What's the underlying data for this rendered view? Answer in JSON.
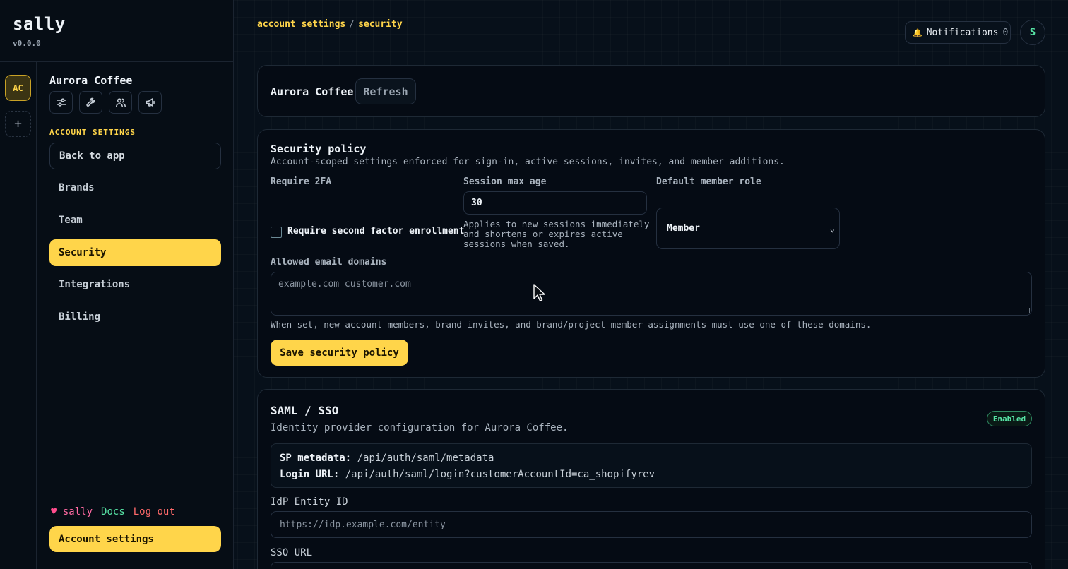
{
  "app": {
    "name": "sally",
    "version": "v0.0.0"
  },
  "rail": {
    "account_initials": "AC",
    "add_label": "+"
  },
  "sidebar": {
    "account_name": "Aurora Coffee",
    "tools": [
      "sliders-icon",
      "wrench-icon",
      "users-icon",
      "megaphone-icon"
    ],
    "section_label": "ACCOUNT SETTINGS",
    "items": [
      {
        "label": "Back to app"
      },
      {
        "label": "Brands"
      },
      {
        "label": "Team"
      },
      {
        "label": "Security"
      },
      {
        "label": "Integrations"
      },
      {
        "label": "Billing"
      }
    ],
    "footer": {
      "heart": "♥",
      "sally": "sally",
      "docs": "Docs",
      "logout": "Log out"
    },
    "account_button": "Account settings"
  },
  "header": {
    "breadcrumb_a": "account settings",
    "breadcrumb_sep": "/",
    "breadcrumb_b": "security",
    "notifications_label": "Notifications",
    "notifications_count": "0",
    "avatar": "S"
  },
  "account_card": {
    "name": "Aurora Coffee",
    "refresh": "Refresh"
  },
  "security_policy": {
    "title": "Security policy",
    "description": "Account-scoped settings enforced for sign-in, active sessions, invites, and member additions.",
    "require_2fa_label": "Require 2FA",
    "require_2fa_checkbox": "Require second factor enrollment",
    "session_label": "Session max age",
    "session_value": "30",
    "session_help_1": "Applies to new sessions immediately",
    "session_help_2": "and shortens or expires active",
    "session_help_3": "sessions when saved.",
    "role_label": "Default member role",
    "role_value": "Member",
    "domains_label": "Allowed email domains",
    "domains_placeholder": "example.com customer.com",
    "domains_help": "When set, new account members, brand invites, and brand/project member assignments must use one of these domains.",
    "save": "Save security policy"
  },
  "saml": {
    "title": "SAML / SSO",
    "status": "Enabled",
    "description": "Identity provider configuration for Aurora Coffee.",
    "sp_metadata_label": "SP metadata:",
    "sp_metadata_value": "/api/auth/saml/metadata",
    "login_url_label": "Login URL:",
    "login_url_value": "/api/auth/saml/login?customerAccountId=ca_shopifyrev",
    "entity_label": "IdP Entity ID",
    "entity_placeholder": "https://idp.example.com/entity",
    "sso_label": "SSO URL"
  }
}
